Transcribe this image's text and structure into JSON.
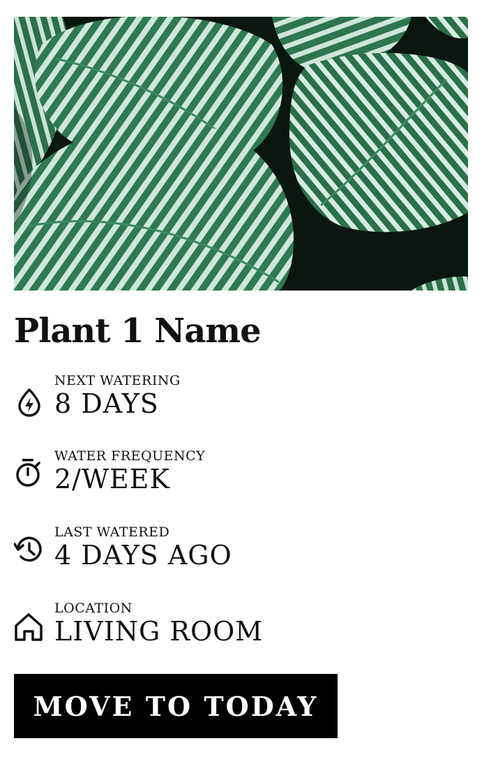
{
  "plant": {
    "name": "Plant 1 Name",
    "image_alt": "Calathea orbifolia leaves",
    "image_icon": "plant-photo"
  },
  "stats": [
    {
      "label": "NEXT WATERING",
      "value": "8 DAYS",
      "icon": "water-drop-bolt-icon"
    },
    {
      "label": "WATER FREQUENCY",
      "value": "2/WEEK",
      "icon": "stopwatch-icon"
    },
    {
      "label": "LAST WATERED",
      "value": "4 DAYS AGO",
      "icon": "history-icon"
    },
    {
      "label": "LOCATION",
      "value": "LIVING ROOM",
      "icon": "home-icon"
    }
  ],
  "actions": {
    "move_label": "MOVE TO TODAY"
  },
  "colors": {
    "text": "#111111",
    "button_bg": "#000000",
    "button_text": "#ffffff",
    "leaf_dark": "#2f7a52",
    "leaf_light": "#d6ebe2"
  }
}
